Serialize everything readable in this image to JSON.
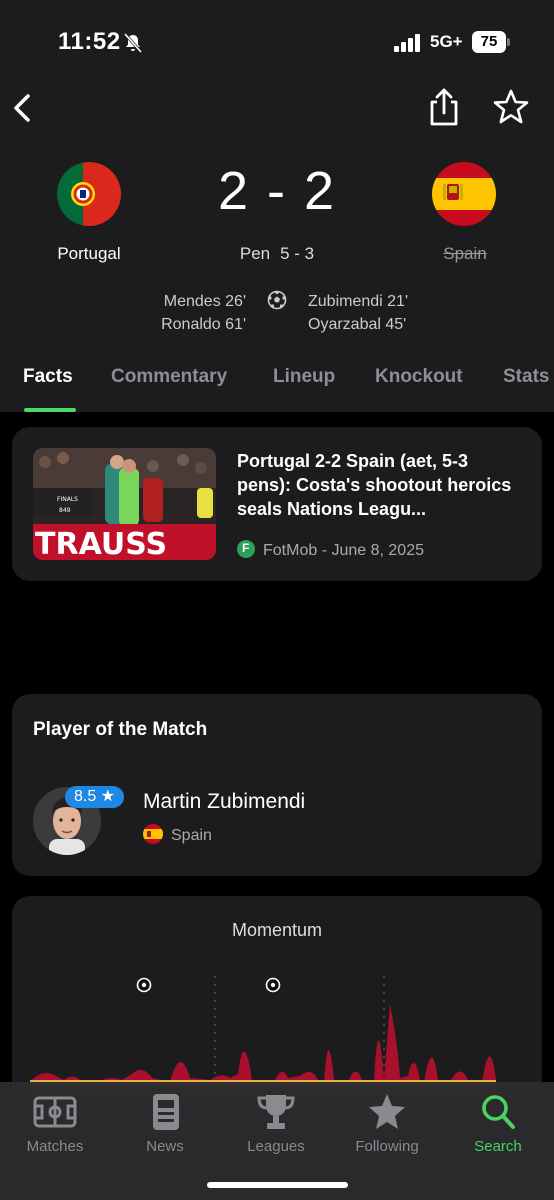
{
  "status_bar": {
    "time": "11:52",
    "network": "5G+",
    "battery": "75"
  },
  "match": {
    "home_team": "Portugal",
    "away_team": "Spain",
    "score": "2 - 2",
    "penalties_label": "Pen",
    "penalties_score": "5 - 3",
    "home_scorers": [
      "Mendes 26'",
      "Ronaldo 61'"
    ],
    "away_scorers": [
      "Zubimendi 21'",
      "Oyarzabal 45'"
    ]
  },
  "tabs": [
    "Facts",
    "Commentary",
    "Lineup",
    "Knockout",
    "Stats"
  ],
  "active_tab": "Facts",
  "news": {
    "title": "Portugal 2-2 Spain (aet, 5-3 pens): Costa's shootout heroics seals Nations Leagu...",
    "source": "FotMob - June 8, 2025",
    "thumb_text": "TRAUSS",
    "thumb_board_1": "FINALS",
    "thumb_board_2": "849"
  },
  "player_of_match": {
    "heading": "Player of the Match",
    "name": "Martin Zubimendi",
    "team": "Spain",
    "rating": "8.5 ★"
  },
  "momentum": {
    "title": "Momentum"
  },
  "bottom_nav": [
    {
      "label": "Matches",
      "icon": "pitch-icon"
    },
    {
      "label": "News",
      "icon": "news-icon"
    },
    {
      "label": "Leagues",
      "icon": "trophy-icon"
    },
    {
      "label": "Following",
      "icon": "star-icon"
    },
    {
      "label": "Search",
      "icon": "search-icon"
    }
  ],
  "colors": {
    "accent": "#4cd964",
    "background": "#000000",
    "card": "#1c1c1e",
    "rating": "#1e88e5",
    "momentum_home": "#a8102c",
    "momentum_away": "#e8b04a"
  }
}
